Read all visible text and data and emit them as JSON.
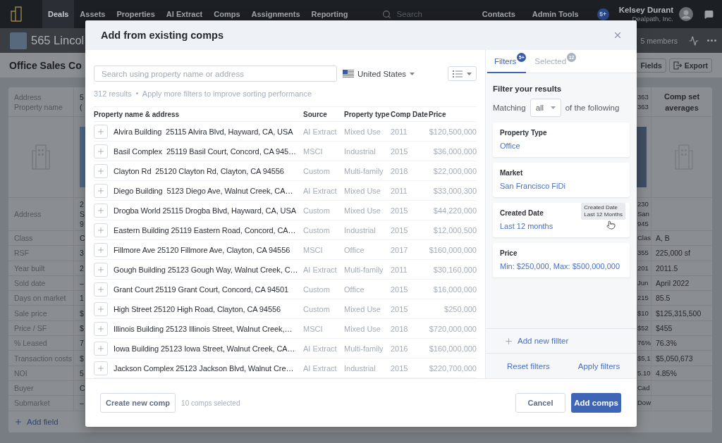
{
  "nav": {
    "items": [
      {
        "label": "Deals",
        "selected": true
      },
      {
        "label": "Assets",
        "selected": false
      },
      {
        "label": "Properties",
        "selected": false
      },
      {
        "label": "AI Extract",
        "selected": false
      },
      {
        "label": "Comps",
        "selected": false
      },
      {
        "label": "Assignments",
        "selected": false
      },
      {
        "label": "Reporting",
        "selected": false
      }
    ],
    "search": {
      "placeholder": "Search"
    },
    "links": [
      "Contacts",
      "Admin Tools"
    ],
    "badge": "5+",
    "user": {
      "name": "Kelsey Durant",
      "company": "Dealpath, Inc."
    }
  },
  "deal_header": {
    "title": "565 Lincol",
    "members": "5 members"
  },
  "page_title": {
    "title": "Office Sales Co",
    "buttons": [
      "Fields",
      "Export"
    ]
  },
  "comp_table": {
    "header": {
      "labels": [
        "Address",
        "Property name"
      ],
      "column_1": [
        "5",
        "("
      ],
      "column_2": [
        "363",
        "363"
      ],
      "averages_title": "Comp set averages"
    },
    "rows": [
      {
        "label": "Address",
        "column_1": [
          "2",
          "S",
          "9"
        ],
        "column_2": [
          "230",
          "San",
          "945"
        ]
      },
      {
        "label": "Class",
        "column_1": [
          "C"
        ],
        "column_2": [
          "Clas"
        ],
        "average": "A, B"
      },
      {
        "label": "RSF",
        "column_1": [
          "3"
        ],
        "column_2": [
          "355"
        ],
        "average": "225,000 sf"
      },
      {
        "label": "Year built",
        "column_1": [
          "2"
        ],
        "column_2": [
          "201"
        ],
        "average": "2011.5"
      },
      {
        "label": "Sold date",
        "column_1": [
          "–"
        ],
        "column_2": [
          "Jun"
        ],
        "average": "April 2022"
      },
      {
        "label": "Days on market",
        "column_1": [
          "1"
        ],
        "column_2": [
          "215"
        ],
        "average": "85.5"
      },
      {
        "label": "Sale price",
        "column_1": [
          "$"
        ],
        "column_2": [
          "$10"
        ],
        "average": "$125,315,500"
      },
      {
        "label": "Price / SF",
        "column_1": [
          "$"
        ],
        "column_2": [
          "$52"
        ],
        "average": "$455"
      },
      {
        "label": "% Leased",
        "column_1": [
          "7"
        ],
        "column_2": [
          "76%"
        ],
        "average": "76.3%"
      },
      {
        "label": "Transaction costs",
        "column_1": [
          "$"
        ],
        "column_2": [
          "$5,1"
        ],
        "average": "$5,050,673"
      },
      {
        "label": "NOI",
        "column_1": [
          "5"
        ],
        "column_2": [
          "5.10"
        ],
        "average": "4.85%"
      },
      {
        "label": "Buyer",
        "column_1": [
          "C"
        ],
        "column_2": [
          "Cad"
        ]
      },
      {
        "label": "Submarket",
        "column_1": [
          "–"
        ],
        "column_2": [
          "Dow"
        ]
      }
    ],
    "add_field": "Add field"
  },
  "modal": {
    "title": "Add from existing comps",
    "search": {
      "placeholder": "Search using property name or address"
    },
    "country": "United States",
    "result_count": "312 results",
    "hint": "Apply more filters to improve sorting performance",
    "columns": [
      "Property name & address",
      "Source",
      "Property type",
      "Comp Date",
      "Price"
    ],
    "rows": [
      {
        "name": "Alvira Building  25115 Alvira Blvd, Hayward, CA, USA",
        "source": "AI Extract",
        "property_type": "Mixed Use",
        "comp_date": "2011",
        "price": "$120,500,000"
      },
      {
        "name": "Basil Complex  25119 Basil Court, Concord, CA 945…",
        "source": "MSCI",
        "property_type": "Industrial",
        "comp_date": "2015",
        "price": "$36,000,000"
      },
      {
        "name": "Clayton Rd  25120 Clayton Rd, Clayton, CA 94556",
        "source": "Custom",
        "property_type": "Multi-family",
        "comp_date": "2018",
        "price": "$22,000,000"
      },
      {
        "name": "Diego Building  5123 Diego Ave, Walnut Creek, CA…",
        "source": "AI Extract",
        "property_type": "Mixed Use",
        "comp_date": "2011",
        "price": "$33,000,300"
      },
      {
        "name": "Drogba World 25115 Drogba Blvd, Hayward, CA, USA",
        "source": "Custom",
        "property_type": "Mixed Use",
        "comp_date": "2015",
        "price": "$44,220,000"
      },
      {
        "name": "Eastern Building 25119 Eastern Road, Concord, CA…",
        "source": "Custom",
        "property_type": "Industrial",
        "comp_date": "2015",
        "price": "$12,000,500"
      },
      {
        "name": "Fillmore Ave 25120 Fillmore Ave, Clayton, CA 94556",
        "source": "MSCI",
        "property_type": "Office",
        "comp_date": "2017",
        "price": "$160,000,000"
      },
      {
        "name": "Gough Building 25123 Gough Way, Walnut Creek, C…",
        "source": "AI Extract",
        "property_type": "Multi-family",
        "comp_date": "2011",
        "price": "$30,160,000"
      },
      {
        "name": "Grant Court 25119 Grant Court, Concord, CA 94501",
        "source": "Custom",
        "property_type": "Office",
        "comp_date": "2015",
        "price": "$16,000,000"
      },
      {
        "name": "High Street 25120 High Road, Clayton, CA 94556",
        "source": "Custom",
        "property_type": "Mixed Use",
        "comp_date": "2015",
        "price": "$250,000"
      },
      {
        "name": "Illinois Building 25123 Illinois Street, Walnut Creek,…",
        "source": "MSCI",
        "property_type": "Mixed Use",
        "comp_date": "2018",
        "price": "$720,000,000"
      },
      {
        "name": "Iowa Building 25123 Iowa Street, Walnut Creek, CA…",
        "source": "AI Extract",
        "property_type": "Multi-family",
        "comp_date": "2016",
        "price": "$160,000,000"
      },
      {
        "name": "Jackson Complex 25123 Jackson Blvd, Walnut Cre…",
        "source": "AI Extract",
        "property_type": "Industrial",
        "comp_date": "2015",
        "price": "$220,700,000"
      }
    ],
    "filters_panel": {
      "tabs": [
        {
          "label": "Filters",
          "badge": "5+",
          "selected": true
        },
        {
          "label": "Selected",
          "badge": "12",
          "selected": false
        }
      ],
      "heading": "Filter your results",
      "matching": {
        "prefix": "Matching",
        "value": "all",
        "suffix": "of the following"
      },
      "filters": [
        {
          "label": "Property Type",
          "value": "Office"
        },
        {
          "label": "Market",
          "value": "San Francisco FiDi"
        },
        {
          "label": "Created Date",
          "value": "Last 12 months",
          "tooltip": [
            "Created Date",
            "Last 12 Months"
          ]
        },
        {
          "label": "Price",
          "value": "Min: $250,000, Max: $500,000,000"
        }
      ],
      "add_filter": "Add new fillter",
      "actions": [
        "Reset filters",
        "Apply filters"
      ]
    },
    "footer": {
      "create_button": "Create new comp",
      "selection_count": "10 comps selected",
      "cancel": "Cancel",
      "submit": "Add comps"
    }
  }
}
